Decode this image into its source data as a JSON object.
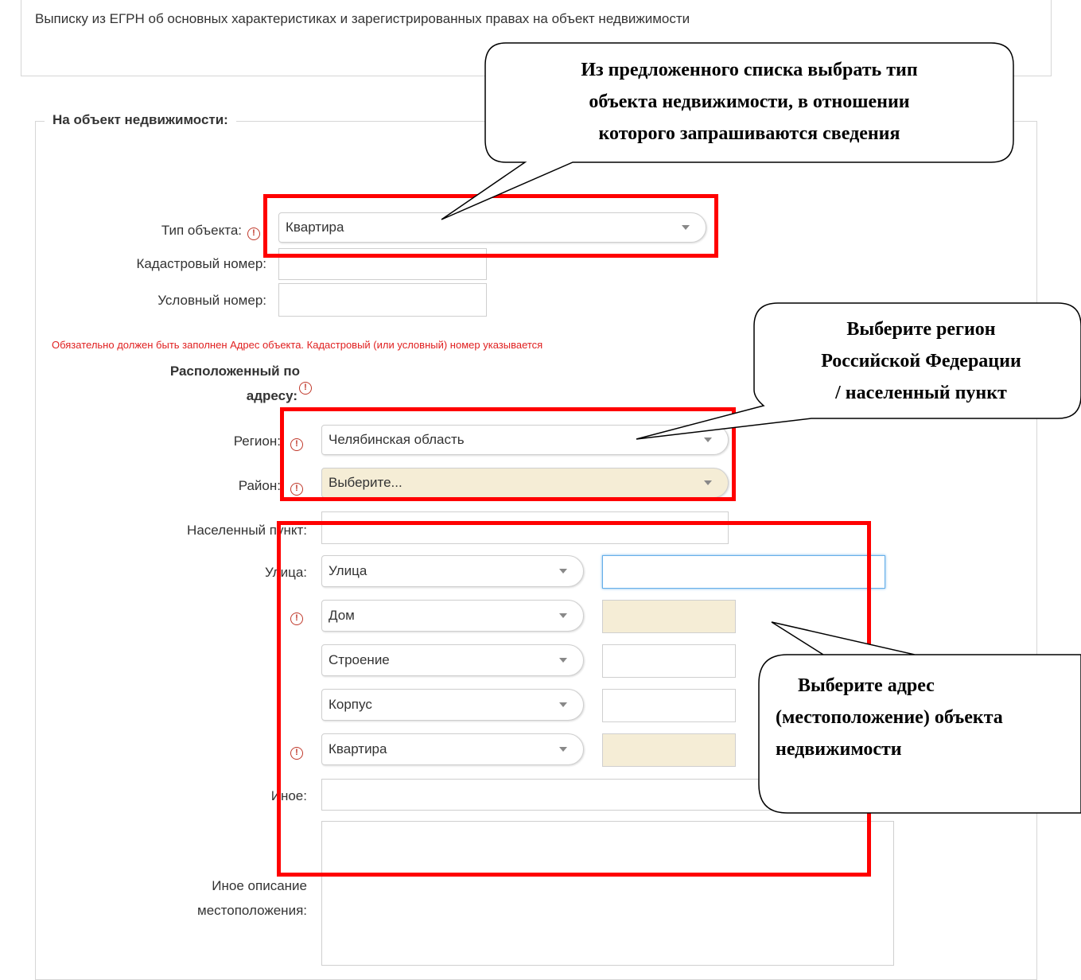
{
  "header": {
    "text": "Выписку из ЕГРН об основных характеристиках и зарегистрированных правах на объект недвижимости"
  },
  "section": {
    "legend": "На объект недвижимости:"
  },
  "form": {
    "object_type_label": "Тип объекта:",
    "object_type_value": "Квартира",
    "cadastral_label": "Кадастровый номер:",
    "conditional_label": "Условный номер:",
    "error_text": "Обязательно должен быть заполнен Адрес объекта. Кадастровый (или условный) номер указывается",
    "address_label_line1": "Расположенный по",
    "address_label_line2": "адресу:",
    "region_label": "Регион:",
    "region_value": "Челябинская область",
    "district_label": "Район:",
    "district_value": "Выберите...",
    "locality_label": "Населенный пункт:",
    "street_label": "Улица:",
    "street_type": "Улица",
    "house_type": "Дом",
    "building_type": "Строение",
    "block_type": "Корпус",
    "apartment_type": "Квартира",
    "other_label": "Иное:",
    "other_desc_label_line1": "Иное описание",
    "other_desc_label_line2": "местоположения:"
  },
  "callouts": {
    "object_type": [
      "Из предложенного списка выбрать тип",
      "объекта недвижимости, в отношении",
      "которого запрашиваются сведения"
    ],
    "region": [
      "Выберите регион",
      "Российской Федерации",
      "/ населенный пункт"
    ],
    "address": [
      "Выберите адрес",
      "(местоположение) объекта",
      "недвижимости"
    ]
  },
  "colors": {
    "highlight": "#ff0000",
    "required_marker": "#c0392b",
    "error_text": "#e02020",
    "disabled_field": "#f5edd6"
  },
  "icons": {
    "required": "exclamation-circle",
    "dropdown": "caret-down"
  }
}
